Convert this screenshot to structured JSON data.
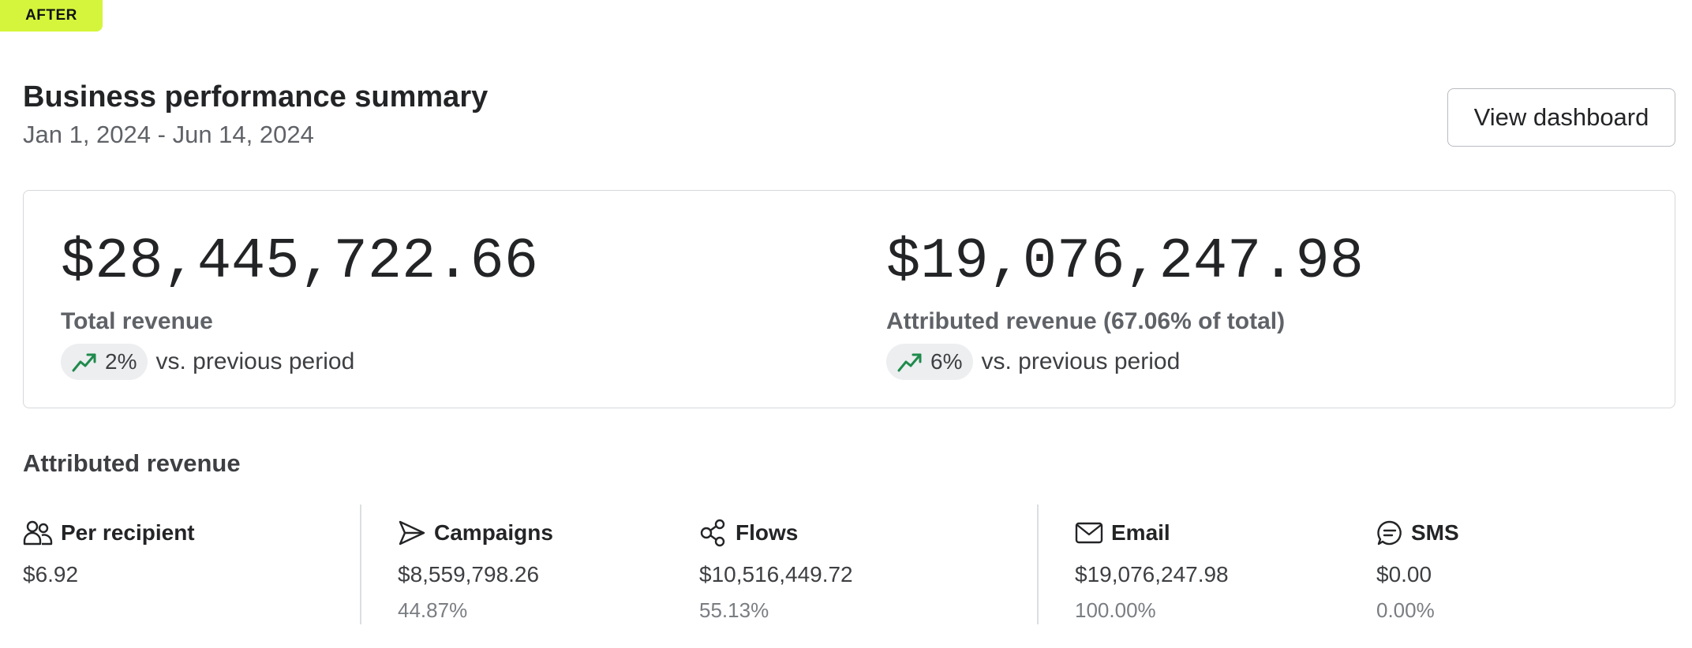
{
  "badge": "AFTER",
  "header": {
    "title": "Business performance summary",
    "date_range": "Jan 1, 2024 - Jun 14, 2024",
    "view_button": "View dashboard"
  },
  "summary": {
    "total": {
      "value": "$28,445,722.66",
      "label": "Total revenue",
      "delta": "2%",
      "delta_suffix": "vs. previous period"
    },
    "attributed": {
      "value": "$19,076,247.98",
      "label": "Attributed revenue (67.06% of total)",
      "delta": "6%",
      "delta_suffix": "vs. previous period"
    }
  },
  "attributed_section": {
    "title": "Attributed revenue",
    "per_recipient": {
      "label": "Per recipient",
      "value": "$6.92",
      "icon": "people-icon"
    },
    "campaigns": {
      "label": "Campaigns",
      "value": "$8,559,798.26",
      "pct": "44.87%",
      "icon": "send-icon"
    },
    "flows": {
      "label": "Flows",
      "value": "$10,516,449.72",
      "pct": "55.13%",
      "icon": "flows-icon"
    },
    "email": {
      "label": "Email",
      "value": "$19,076,247.98",
      "pct": "100.00%",
      "icon": "mail-icon"
    },
    "sms": {
      "label": "SMS",
      "value": "$0.00",
      "pct": "0.00%",
      "icon": "chat-icon"
    }
  },
  "colors": {
    "badge": "#d4f53c",
    "trend_up": "#1f8a4c",
    "text": "#232426",
    "muted": "#5f6267"
  }
}
